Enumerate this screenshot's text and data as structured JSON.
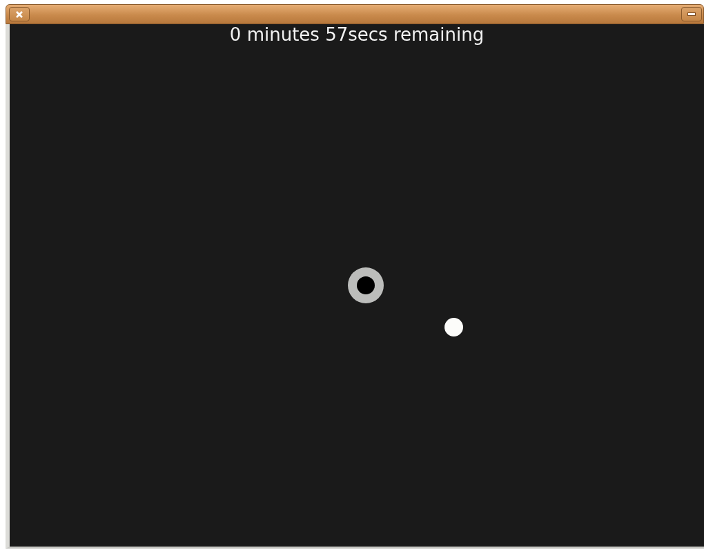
{
  "window": {
    "buttons": [
      {
        "kind": "close"
      },
      {
        "kind": "minimize"
      }
    ]
  },
  "timer": {
    "text": "0 minutes 57secs remaining"
  },
  "canvas": {
    "items": [
      {
        "kind": "target"
      },
      {
        "kind": "dot"
      }
    ]
  }
}
